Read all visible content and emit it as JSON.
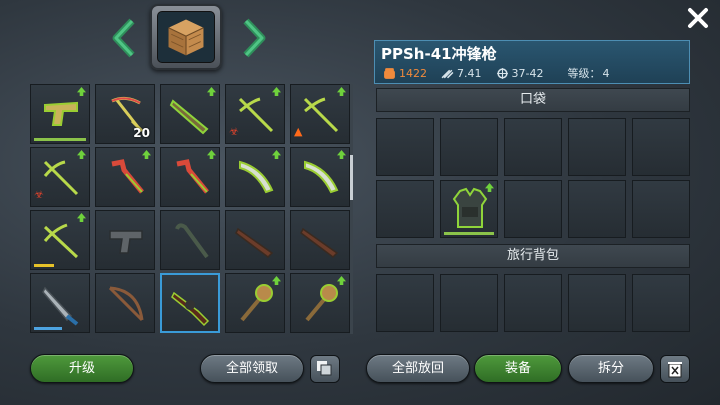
{
  "header": {
    "left_arrow": "chevron-left-icon",
    "right_arrow": "chevron-right-icon",
    "center_icon": "crate-icon",
    "close_icon": "close-icon"
  },
  "item_info": {
    "name": "PPSh-41冲锋枪",
    "power": "1422",
    "speed": "7.41",
    "damage": "37-42",
    "level_label": "等级：",
    "level": "4"
  },
  "sections": {
    "pocket": "口袋",
    "backpack": "旅行背包"
  },
  "inventory": {
    "selected_count": "20"
  },
  "buttons": {
    "upgrade": "升级",
    "collect_all": "全部领取",
    "return_all": "全部放回",
    "equip": "装备",
    "disassemble": "拆分"
  },
  "colors": {
    "accent_green": "#4f9a3c",
    "info_blue": "#2a5670",
    "select_blue": "#3a9bd8",
    "power_orange": "#f08a3c"
  }
}
